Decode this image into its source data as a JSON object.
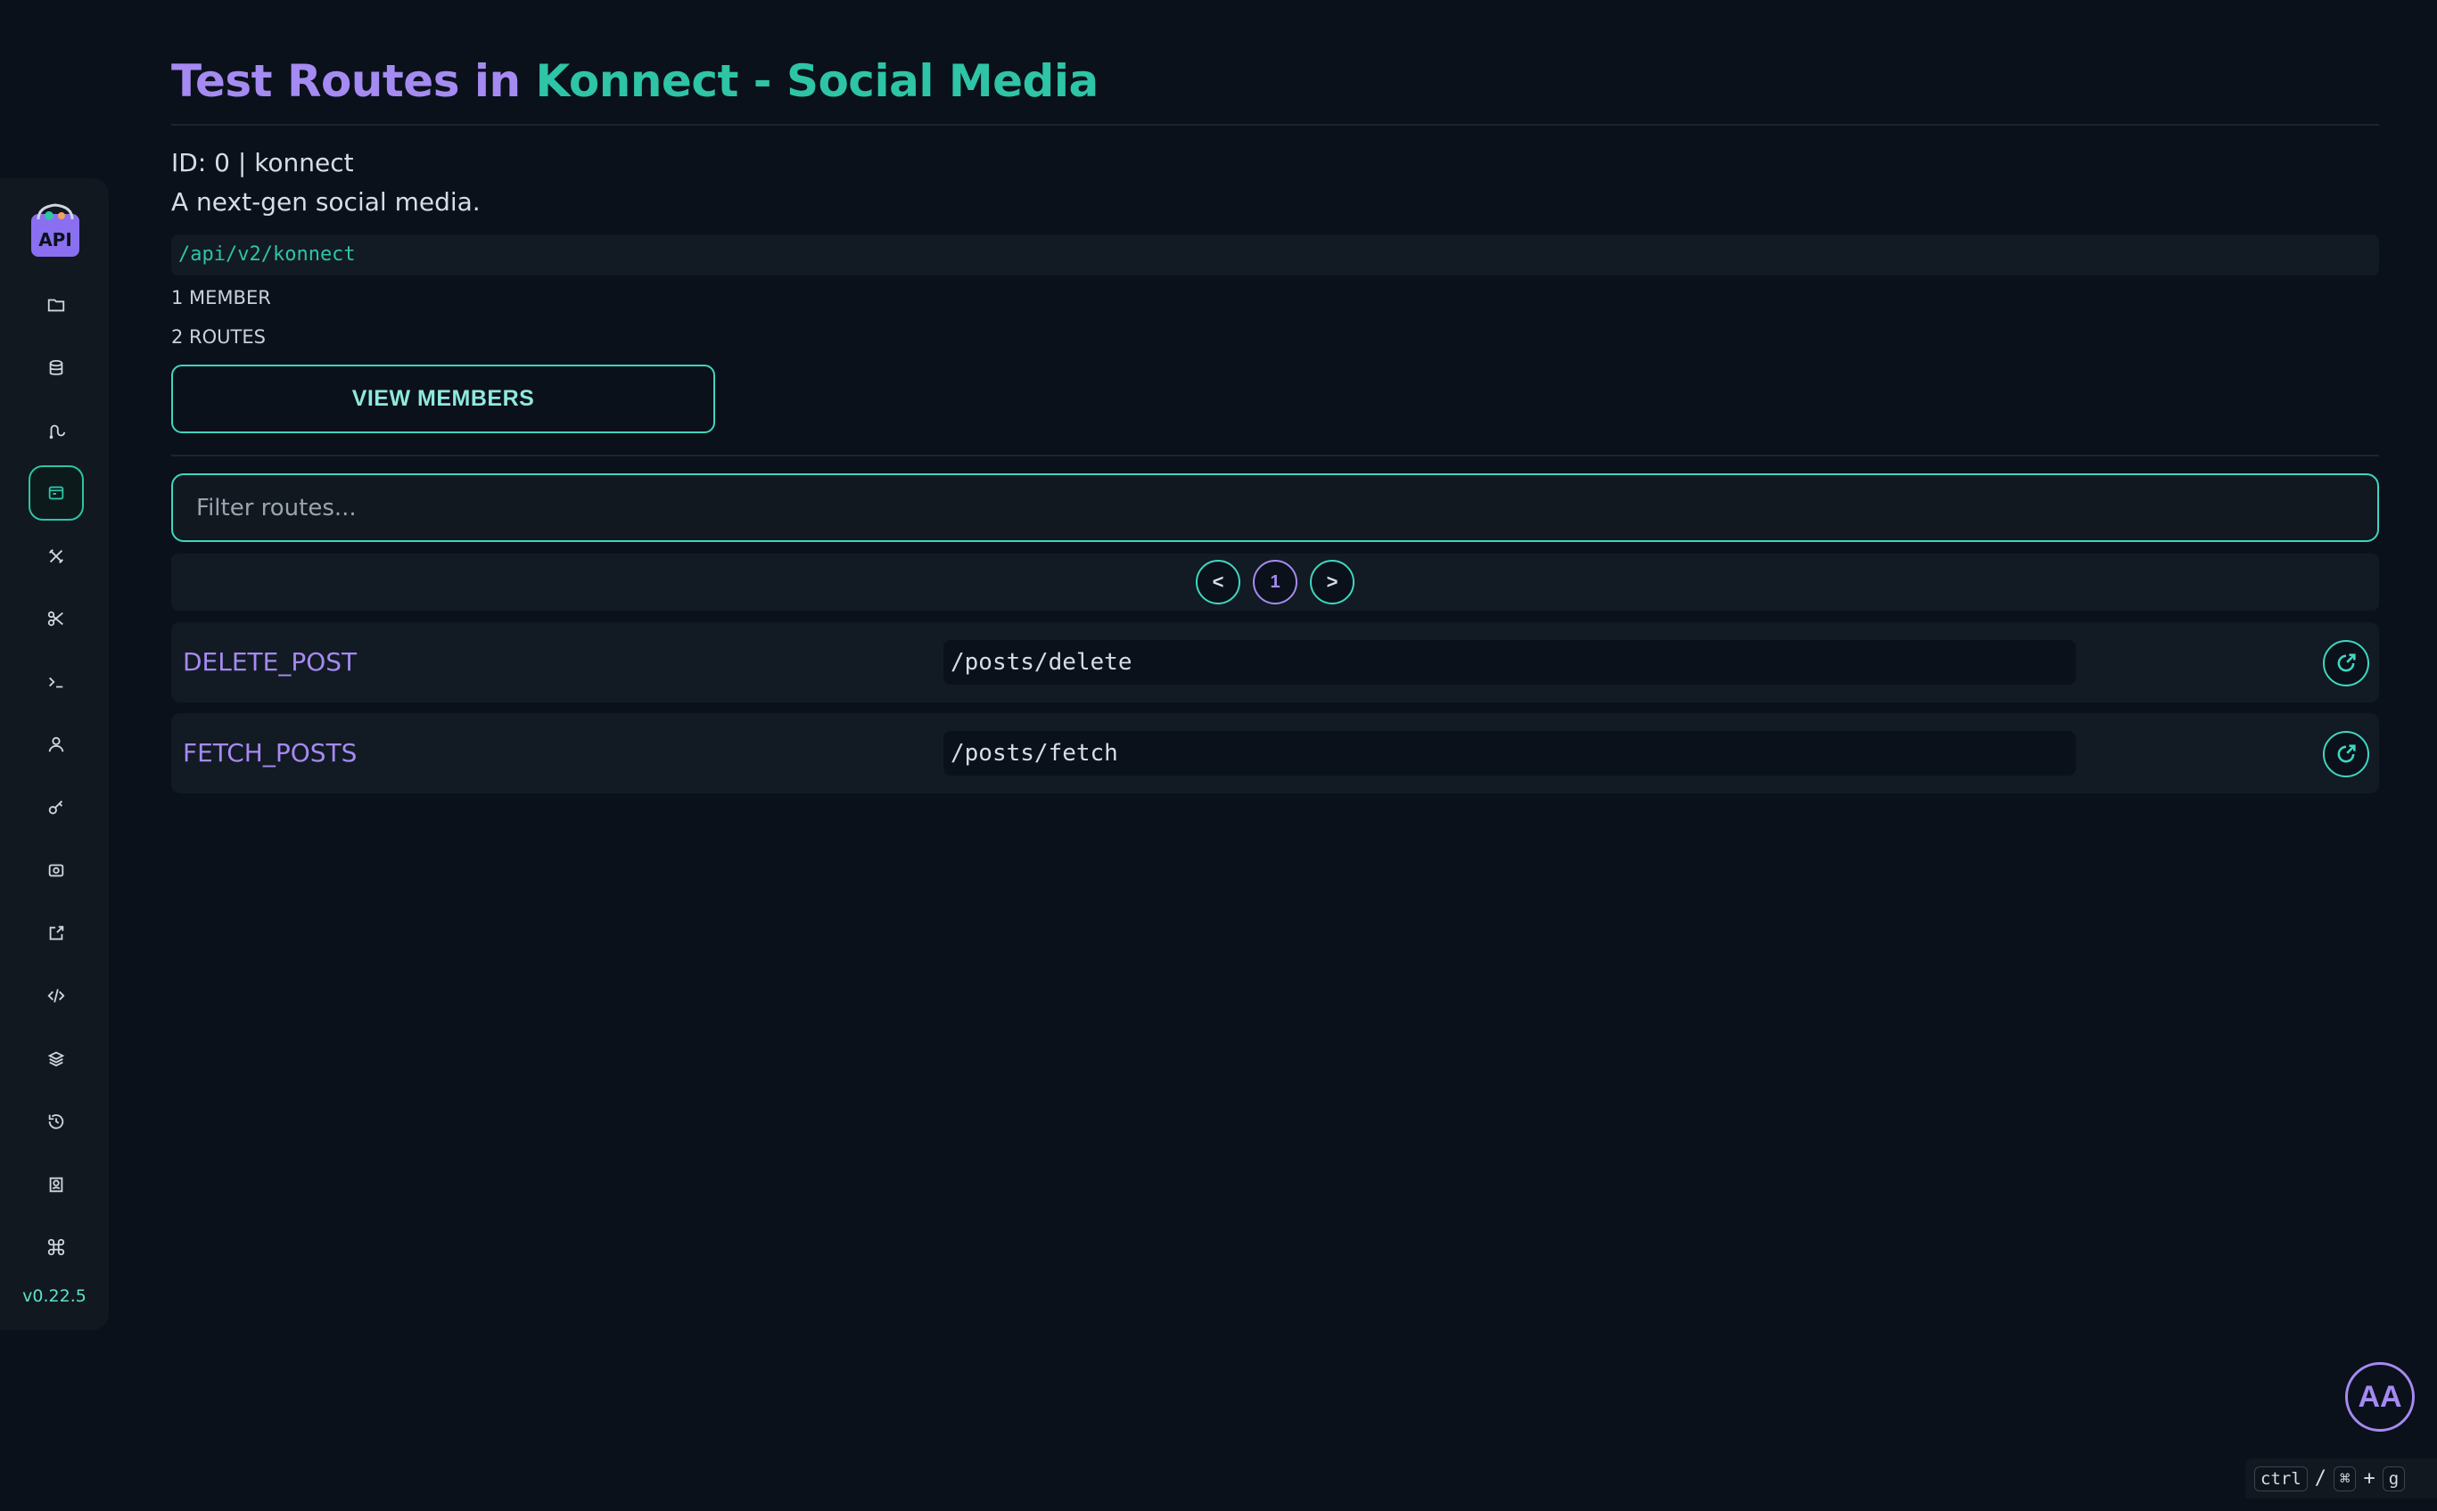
{
  "header": {
    "title_part1": "Test Routes in ",
    "title_part2": "Konnect - Social Media"
  },
  "project": {
    "id_line": "ID: 0 | konnect",
    "description": "A next-gen social media.",
    "endpoint": "/api/v2/konnect",
    "members_count": "1 MEMBER",
    "routes_count": "2 ROUTES",
    "view_members_label": "VIEW MEMBERS"
  },
  "filter": {
    "placeholder": "Filter routes...",
    "value": ""
  },
  "pagination": {
    "prev_label": "<",
    "current_page": "1",
    "next_label": ">"
  },
  "routes": [
    {
      "name": "DELETE_POST",
      "path": "/posts/delete"
    },
    {
      "name": "FETCH_POSTS",
      "path": "/posts/fetch"
    }
  ],
  "sidebar": {
    "logo_text": "API",
    "items": [
      {
        "icon": "folder-icon"
      },
      {
        "icon": "database-icon"
      },
      {
        "icon": "routes-icon"
      },
      {
        "icon": "browser-window-icon",
        "active": true
      },
      {
        "icon": "tools-icon"
      },
      {
        "icon": "scissors-icon"
      },
      {
        "icon": "terminal-icon"
      },
      {
        "icon": "user-icon"
      },
      {
        "icon": "key-icon"
      },
      {
        "icon": "camera-icon"
      },
      {
        "icon": "external-link-icon"
      },
      {
        "icon": "code-icon"
      },
      {
        "icon": "layers-icon"
      },
      {
        "icon": "history-icon"
      },
      {
        "icon": "user-check-icon"
      },
      {
        "icon": "command-icon"
      }
    ],
    "version": "v0.22.5"
  },
  "accessibility_button_label": "AA",
  "shortcut": {
    "key1": "ctrl",
    "separator": "/",
    "key2": "⌘",
    "plus": "+",
    "key3": "g"
  },
  "colors": {
    "background": "#0a111a",
    "accent_purple": "#a58af2",
    "accent_teal": "#2ec4a6",
    "panel": "#121a23"
  }
}
